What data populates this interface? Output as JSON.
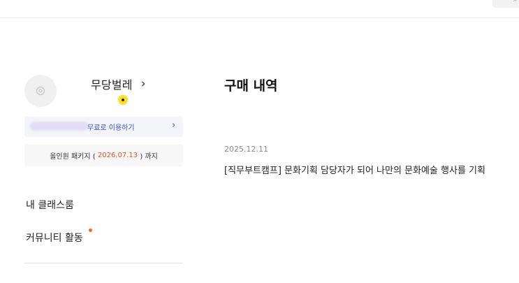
{
  "header": {
    "search_icon": "search-icon"
  },
  "profile": {
    "avatar_icon": "avatar-placeholder-icon",
    "name": "무당벌레",
    "chevron": "›",
    "badge_color": "#f7e326"
  },
  "promo": {
    "label": "무료로 이용하기",
    "chevron": "›",
    "accent": "#3e4cc7"
  },
  "package": {
    "prefix": "올인원 패키지 (",
    "date": "2026.07.13",
    "suffix": ") 까지",
    "date_color": "#e0522d"
  },
  "nav": {
    "classroom": "내 클래스룸",
    "community": "커뮤니티 활동",
    "community_notification_color": "#f26b2a"
  },
  "purchases": {
    "title": "구매 내역",
    "orders": [
      {
        "date": "2025.12.11",
        "title": "[직무부트캠프] 문화기획 담당자가 되어 나만의 문화예술 행사를 기획"
      }
    ]
  }
}
